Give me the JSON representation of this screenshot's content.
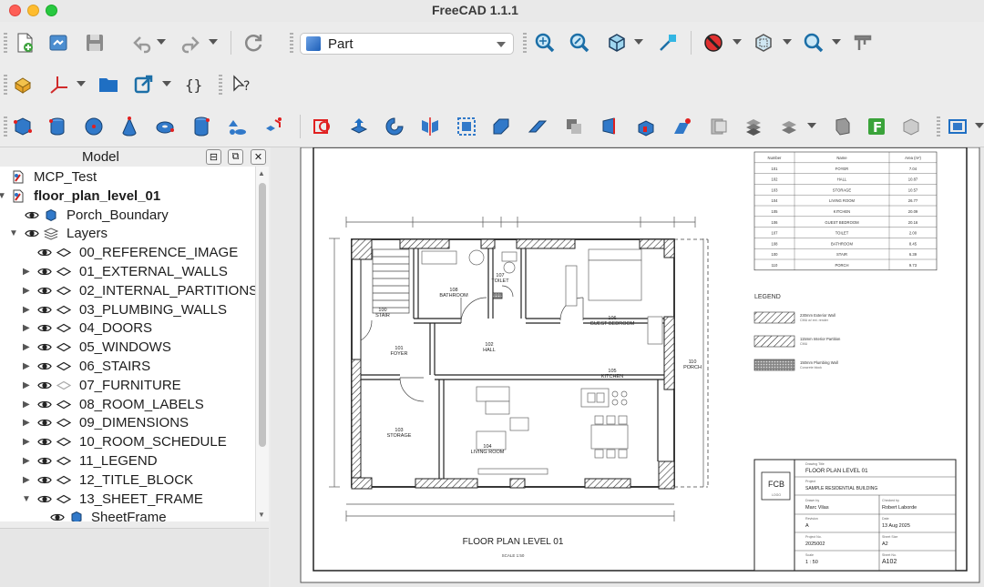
{
  "window": {
    "title": "FreeCAD 1.1.1"
  },
  "toolbar": {
    "workbench": "Part"
  },
  "model_panel": {
    "title": "Model",
    "tree": [
      {
        "label": "MCP_Test",
        "level": 0,
        "bold": false
      },
      {
        "label": "floor_plan_level_01",
        "level": 0,
        "bold": true
      },
      {
        "label": "Porch_Boundary",
        "level": 1,
        "bold": false
      },
      {
        "label": "Layers",
        "level": 1,
        "bold": false
      },
      {
        "label": "00_REFERENCE_IMAGE",
        "level": 2,
        "bold": false
      },
      {
        "label": "01_EXTERNAL_WALLS",
        "level": 2,
        "bold": false
      },
      {
        "label": "02_INTERNAL_PARTITIONS",
        "level": 2,
        "bold": false
      },
      {
        "label": "03_PLUMBING_WALLS",
        "level": 2,
        "bold": false
      },
      {
        "label": "04_DOORS",
        "level": 2,
        "bold": false
      },
      {
        "label": "05_WINDOWS",
        "level": 2,
        "bold": false
      },
      {
        "label": "06_STAIRS",
        "level": 2,
        "bold": false
      },
      {
        "label": "07_FURNITURE",
        "level": 2,
        "bold": false
      },
      {
        "label": "08_ROOM_LABELS",
        "level": 2,
        "bold": false
      },
      {
        "label": "09_DIMENSIONS",
        "level": 2,
        "bold": false
      },
      {
        "label": "10_ROOM_SCHEDULE",
        "level": 2,
        "bold": false
      },
      {
        "label": "11_LEGEND",
        "level": 2,
        "bold": false
      },
      {
        "label": "12_TITLE_BLOCK",
        "level": 2,
        "bold": false
      },
      {
        "label": "13_SHEET_FRAME",
        "level": 2,
        "bold": false
      },
      {
        "label": "SheetFrame",
        "level": 3,
        "bold": false
      }
    ]
  },
  "drawing": {
    "plan_title": "FLOOR PLAN LEVEL 01",
    "scale_note": "SCALE 1:50",
    "rooms": [
      {
        "num": "100",
        "name": "STAIR"
      },
      {
        "num": "101",
        "name": "FOYER"
      },
      {
        "num": "102",
        "name": "HALL"
      },
      {
        "num": "103",
        "name": "STORAGE"
      },
      {
        "num": "104",
        "name": "LIVING ROOM"
      },
      {
        "num": "105",
        "name": "KITCHEN"
      },
      {
        "num": "106",
        "name": "GUEST BEDROOM"
      },
      {
        "num": "107",
        "name": "TOILET"
      },
      {
        "num": "108",
        "name": "BATHROOM"
      },
      {
        "num": "110",
        "name": "PORCH"
      }
    ],
    "schedule": {
      "headers": [
        "Number",
        "Name",
        "Area (m²)"
      ],
      "rows": [
        [
          "101",
          "FOYER",
          "7.04"
        ],
        [
          "102",
          "HALL",
          "10.87"
        ],
        [
          "103",
          "STORAGE",
          "10.57"
        ],
        [
          "104",
          "LIVING ROOM",
          "26.77"
        ],
        [
          "105",
          "KITCHEN",
          "20.09"
        ],
        [
          "106",
          "GUEST BEDROOM",
          "20.16"
        ],
        [
          "107",
          "TOILET",
          "2.00"
        ],
        [
          "108",
          "BATHROOM",
          "8.45"
        ],
        [
          "100",
          "STAIR",
          "6.39"
        ],
        [
          "110",
          "PORCH",
          "9.73"
        ]
      ]
    },
    "legend": {
      "title": "LEGEND",
      "items": [
        {
          "label": "230mm Exterior Wall",
          "sub": "CMU w/ ext. render"
        },
        {
          "label": "115mm Interior Partition",
          "sub": "CMU"
        },
        {
          "label": "150mm Plumbing Wall",
          "sub": "Concrete block"
        }
      ]
    },
    "title_block": {
      "logo": "FCB",
      "logo_sub": "LOGO",
      "drawing_title_label": "Drawing Title",
      "drawing_title": "FLOOR PLAN LEVEL 01",
      "project_label": "Project",
      "project": "SAMPLE RESIDENTIAL BUILDING",
      "drawn_label": "Drawn by",
      "drawn": "Marc Vilas",
      "checked_label": "Checked by",
      "checked": "Robert Laborde",
      "rev_label": "Revision",
      "rev": "A",
      "date_label": "Date",
      "date": "13 Aug 2025",
      "project_no_label": "Project No.",
      "project_no": "2025002",
      "sheet_size_label": "Sheet Size",
      "sheet_size": "A2",
      "scale_label": "Scale",
      "scale": "1 : 50",
      "sheet_no_label": "Sheet No.",
      "sheet_no": "A102"
    }
  }
}
